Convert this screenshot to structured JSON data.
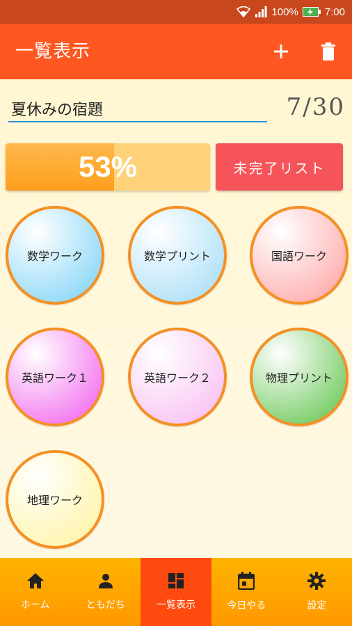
{
  "status_bar": {
    "battery": "100%",
    "time": "7:00"
  },
  "app_bar": {
    "title": "一覧表示",
    "add_icon": "plus-icon",
    "delete_icon": "trash-icon"
  },
  "list": {
    "name": "夏休みの宿題",
    "counter": "7/30",
    "progress_text": "53%",
    "progress_value": 53,
    "incomplete_button": "未完了リスト"
  },
  "tasks": [
    {
      "label": "数学ワーク",
      "color": "#7ED3F7"
    },
    {
      "label": "数学プリント",
      "color": "#A5DDF7"
    },
    {
      "label": "国語ワーク",
      "color": "#FFA3A3"
    },
    {
      "label": "英語ワーク１",
      "color": "#F262EE"
    },
    {
      "label": "英語ワーク２",
      "color": "#F7BCF2"
    },
    {
      "label": "物理プリント",
      "color": "#63C54F"
    },
    {
      "label": "地理ワーク",
      "color": "#FFF3A0"
    }
  ],
  "bottom_nav": [
    {
      "label": "ホーム",
      "icon": "home-icon",
      "active": false
    },
    {
      "label": "ともだち",
      "icon": "person-icon",
      "active": false
    },
    {
      "label": "一覧表示",
      "icon": "dashboard-icon",
      "active": true
    },
    {
      "label": "今日やる",
      "icon": "calendar-icon",
      "active": false
    },
    {
      "label": "設定",
      "icon": "gear-icon",
      "active": false
    }
  ],
  "colors": {
    "status_bar": "#C8471D",
    "app_bar": "#FF5722",
    "progress": "#FF9F1C",
    "incomplete_button": "#F5545A",
    "circle_border": "#F59024",
    "nav_active": "#FF4A0F"
  }
}
